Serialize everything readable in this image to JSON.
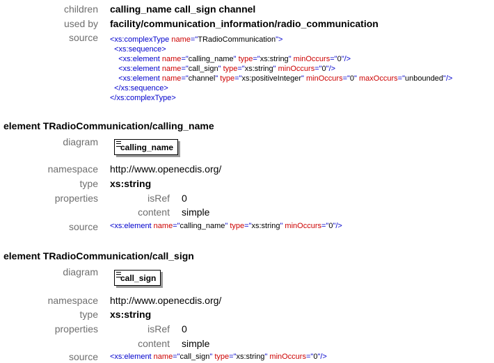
{
  "top": {
    "children_label": "children",
    "children_value": "calling_name call_sign channel",
    "usedby_label": "used by",
    "usedby_value": "facility/communication_information/radio_communication",
    "source_label": "source",
    "source_lines": [
      [
        {
          "t": "tag",
          "v": "<xs:complexType "
        },
        {
          "t": "attr",
          "v": "name"
        },
        {
          "t": "tag",
          "v": "=\""
        },
        {
          "t": "str",
          "v": "TRadioCommunication"
        },
        {
          "t": "tag",
          "v": "\">"
        }
      ],
      [
        {
          "t": "tag",
          "v": "  <xs:sequence>"
        }
      ],
      [
        {
          "t": "tag",
          "v": "    <xs:element "
        },
        {
          "t": "attr",
          "v": "name"
        },
        {
          "t": "tag",
          "v": "=\""
        },
        {
          "t": "str",
          "v": "calling_name"
        },
        {
          "t": "tag",
          "v": "\" "
        },
        {
          "t": "attr",
          "v": "type"
        },
        {
          "t": "tag",
          "v": "=\""
        },
        {
          "t": "str",
          "v": "xs:string"
        },
        {
          "t": "tag",
          "v": "\" "
        },
        {
          "t": "attr",
          "v": "minOccurs"
        },
        {
          "t": "tag",
          "v": "=\""
        },
        {
          "t": "str",
          "v": "0"
        },
        {
          "t": "tag",
          "v": "\"/>"
        }
      ],
      [
        {
          "t": "tag",
          "v": "    <xs:element "
        },
        {
          "t": "attr",
          "v": "name"
        },
        {
          "t": "tag",
          "v": "=\""
        },
        {
          "t": "str",
          "v": "call_sign"
        },
        {
          "t": "tag",
          "v": "\" "
        },
        {
          "t": "attr",
          "v": "type"
        },
        {
          "t": "tag",
          "v": "=\""
        },
        {
          "t": "str",
          "v": "xs:string"
        },
        {
          "t": "tag",
          "v": "\" "
        },
        {
          "t": "attr",
          "v": "minOccurs"
        },
        {
          "t": "tag",
          "v": "=\""
        },
        {
          "t": "str",
          "v": "0"
        },
        {
          "t": "tag",
          "v": "\"/>"
        }
      ],
      [
        {
          "t": "tag",
          "v": "    <xs:element "
        },
        {
          "t": "attr",
          "v": "name"
        },
        {
          "t": "tag",
          "v": "=\""
        },
        {
          "t": "str",
          "v": "channel"
        },
        {
          "t": "tag",
          "v": "\" "
        },
        {
          "t": "attr",
          "v": "type"
        },
        {
          "t": "tag",
          "v": "=\""
        },
        {
          "t": "str",
          "v": "xs:positiveInteger"
        },
        {
          "t": "tag",
          "v": "\" "
        },
        {
          "t": "attr",
          "v": "minOccurs"
        },
        {
          "t": "tag",
          "v": "=\""
        },
        {
          "t": "str",
          "v": "0"
        },
        {
          "t": "tag",
          "v": "\" "
        },
        {
          "t": "attr",
          "v": "maxOccurs"
        },
        {
          "t": "tag",
          "v": "=\""
        },
        {
          "t": "str",
          "v": "unbounded"
        },
        {
          "t": "tag",
          "v": "\"/>"
        }
      ],
      [
        {
          "t": "tag",
          "v": "  </xs:sequence>"
        }
      ],
      [
        {
          "t": "tag",
          "v": "</xs:complexType>"
        }
      ]
    ]
  },
  "sections": [
    {
      "heading": "element TRadioCommunication/calling_name",
      "diagram_label": "diagram",
      "diagram_box": "calling_name",
      "namespace_label": "namespace",
      "namespace_value": "http://www.openecdis.org/",
      "type_label": "type",
      "type_value": "xs:string",
      "properties_label": "properties",
      "isref_label": "isRef",
      "isref_value": "0",
      "content_label": "content",
      "content_value": "simple",
      "source_label": "source",
      "source_line": [
        {
          "t": "tag",
          "v": "<xs:element "
        },
        {
          "t": "attr",
          "v": "name"
        },
        {
          "t": "tag",
          "v": "=\""
        },
        {
          "t": "str",
          "v": "calling_name"
        },
        {
          "t": "tag",
          "v": "\" "
        },
        {
          "t": "attr",
          "v": "type"
        },
        {
          "t": "tag",
          "v": "=\""
        },
        {
          "t": "str",
          "v": "xs:string"
        },
        {
          "t": "tag",
          "v": "\" "
        },
        {
          "t": "attr",
          "v": "minOccurs"
        },
        {
          "t": "tag",
          "v": "=\""
        },
        {
          "t": "str",
          "v": "0"
        },
        {
          "t": "tag",
          "v": "\"/>"
        }
      ]
    },
    {
      "heading": "element TRadioCommunication/call_sign",
      "diagram_label": "diagram",
      "diagram_box": "call_sign",
      "namespace_label": "namespace",
      "namespace_value": "http://www.openecdis.org/",
      "type_label": "type",
      "type_value": "xs:string",
      "properties_label": "properties",
      "isref_label": "isRef",
      "isref_value": "0",
      "content_label": "content",
      "content_value": "simple",
      "source_label": "source",
      "source_line": [
        {
          "t": "tag",
          "v": "<xs:element "
        },
        {
          "t": "attr",
          "v": "name"
        },
        {
          "t": "tag",
          "v": "=\""
        },
        {
          "t": "str",
          "v": "call_sign"
        },
        {
          "t": "tag",
          "v": "\" "
        },
        {
          "t": "attr",
          "v": "type"
        },
        {
          "t": "tag",
          "v": "=\""
        },
        {
          "t": "str",
          "v": "xs:string"
        },
        {
          "t": "tag",
          "v": "\" "
        },
        {
          "t": "attr",
          "v": "minOccurs"
        },
        {
          "t": "tag",
          "v": "=\""
        },
        {
          "t": "str",
          "v": "0"
        },
        {
          "t": "tag",
          "v": "\"/>"
        }
      ]
    }
  ]
}
